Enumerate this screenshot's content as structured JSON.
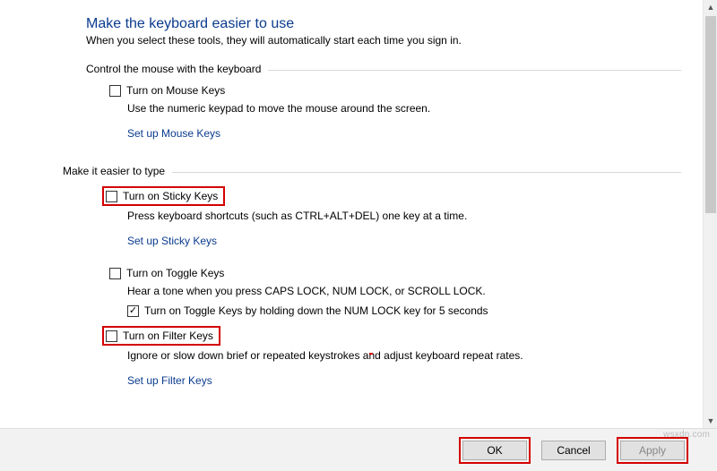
{
  "page": {
    "title": "Make the keyboard easier to use",
    "subtitle": "When you select these tools, they will automatically start each time you sign in."
  },
  "groups": {
    "mouse": {
      "title": "Control the mouse with the keyboard",
      "checkbox_label": "Turn on Mouse Keys",
      "desc": "Use the numeric keypad to move the mouse around the screen.",
      "link": "Set up Mouse Keys"
    },
    "type": {
      "title": "Make it easier to type",
      "sticky_label": "Turn on Sticky Keys",
      "sticky_desc": "Press keyboard shortcuts (such as CTRL+ALT+DEL) one key at a time.",
      "sticky_link": "Set up Sticky Keys",
      "toggle_label": "Turn on Toggle Keys",
      "toggle_desc": "Hear a tone when you press CAPS LOCK, NUM LOCK, or SCROLL LOCK.",
      "toggle_hold_label": "Turn on Toggle Keys by holding down the NUM LOCK key for 5 seconds",
      "filter_label": "Turn on Filter Keys",
      "filter_desc": "Ignore or slow down brief or repeated keystrokes and adjust keyboard repeat rates.",
      "filter_link": "Set up Filter Keys"
    }
  },
  "footer": {
    "ok": "OK",
    "cancel": "Cancel",
    "apply": "Apply"
  },
  "watermark": "wsxdn.com"
}
